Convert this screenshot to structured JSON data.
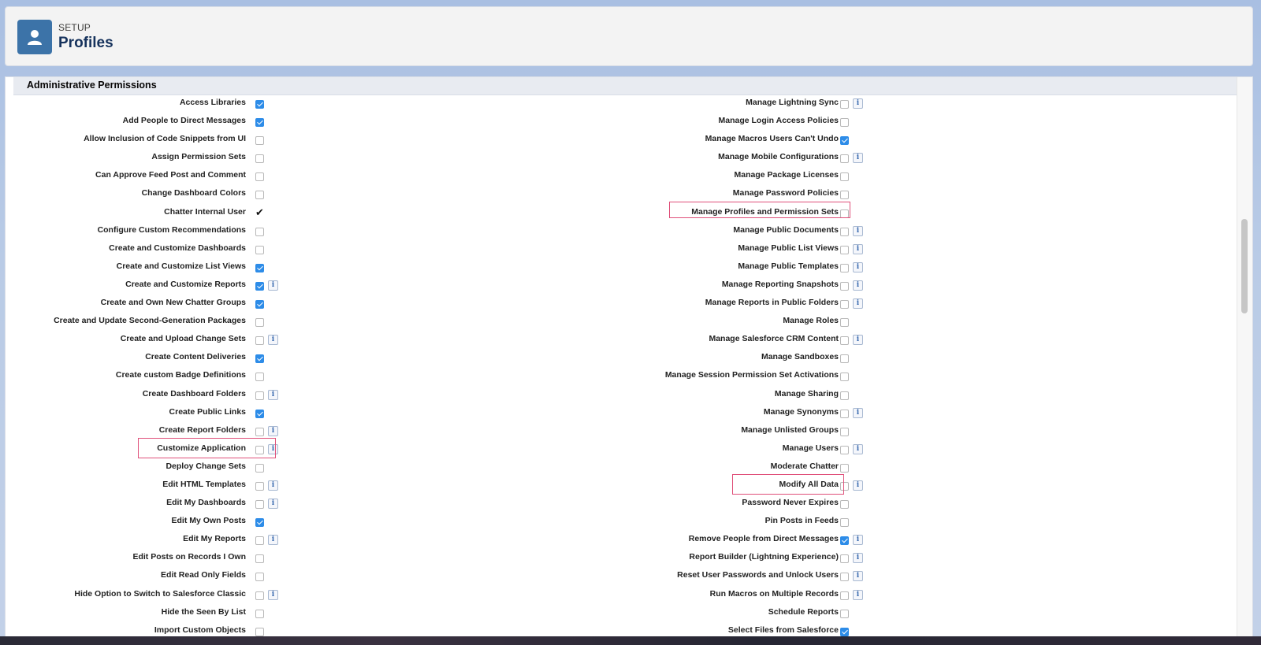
{
  "header": {
    "eyebrow": "SETUP",
    "title": "Profiles",
    "icon": "user-icon"
  },
  "section": {
    "title": "Administrative Permissions"
  },
  "left_permissions": [
    {
      "label": "Access Libraries",
      "state": "checked",
      "info": false
    },
    {
      "label": "Add People to Direct Messages",
      "state": "checked",
      "info": false
    },
    {
      "label": "Allow Inclusion of Code Snippets from UI",
      "state": "unchecked",
      "info": false
    },
    {
      "label": "Assign Permission Sets",
      "state": "unchecked",
      "info": false
    },
    {
      "label": "Can Approve Feed Post and Comment",
      "state": "unchecked",
      "info": false
    },
    {
      "label": "Change Dashboard Colors",
      "state": "unchecked",
      "info": false
    },
    {
      "label": "Chatter Internal User",
      "state": "tick",
      "info": false
    },
    {
      "label": "Configure Custom Recommendations",
      "state": "unchecked",
      "info": false
    },
    {
      "label": "Create and Customize Dashboards",
      "state": "unchecked",
      "info": false
    },
    {
      "label": "Create and Customize List Views",
      "state": "checked",
      "info": false
    },
    {
      "label": "Create and Customize Reports",
      "state": "checked",
      "info": true
    },
    {
      "label": "Create and Own New Chatter Groups",
      "state": "checked",
      "info": false
    },
    {
      "label": "Create and Update Second-Generation Packages",
      "state": "unchecked",
      "info": false
    },
    {
      "label": "Create and Upload Change Sets",
      "state": "unchecked",
      "info": true
    },
    {
      "label": "Create Content Deliveries",
      "state": "checked",
      "info": false
    },
    {
      "label": "Create custom Badge Definitions",
      "state": "unchecked",
      "info": false
    },
    {
      "label": "Create Dashboard Folders",
      "state": "unchecked",
      "info": true
    },
    {
      "label": "Create Public Links",
      "state": "checked",
      "info": false
    },
    {
      "label": "Create Report Folders",
      "state": "unchecked",
      "info": true
    },
    {
      "label": "Customize Application",
      "state": "unchecked",
      "info": true,
      "highlight": true
    },
    {
      "label": "Deploy Change Sets",
      "state": "unchecked",
      "info": false
    },
    {
      "label": "Edit HTML Templates",
      "state": "unchecked",
      "info": true
    },
    {
      "label": "Edit My Dashboards",
      "state": "unchecked",
      "info": true
    },
    {
      "label": "Edit My Own Posts",
      "state": "checked",
      "info": false
    },
    {
      "label": "Edit My Reports",
      "state": "unchecked",
      "info": true
    },
    {
      "label": "Edit Posts on Records I Own",
      "state": "unchecked",
      "info": false
    },
    {
      "label": "Edit Read Only Fields",
      "state": "unchecked",
      "info": false
    },
    {
      "label": "Hide Option to Switch to Salesforce Classic",
      "state": "unchecked",
      "info": true
    },
    {
      "label": "Hide the Seen By List",
      "state": "unchecked",
      "info": false
    },
    {
      "label": "Import Custom Objects",
      "state": "unchecked",
      "info": false
    }
  ],
  "right_permissions": [
    {
      "label": "Manage Lightning Sync",
      "state": "unchecked",
      "info": true
    },
    {
      "label": "Manage Login Access Policies",
      "state": "unchecked",
      "info": false
    },
    {
      "label": "Manage Macros Users Can't Undo",
      "state": "checked",
      "info": false
    },
    {
      "label": "Manage Mobile Configurations",
      "state": "unchecked",
      "info": true
    },
    {
      "label": "Manage Package Licenses",
      "state": "unchecked",
      "info": false
    },
    {
      "label": "Manage Password Policies",
      "state": "unchecked",
      "info": false
    },
    {
      "label": "Manage Profiles and Permission Sets",
      "state": "unchecked",
      "info": false,
      "highlight": true
    },
    {
      "label": "Manage Public Documents",
      "state": "unchecked",
      "info": true
    },
    {
      "label": "Manage Public List Views",
      "state": "unchecked",
      "info": true
    },
    {
      "label": "Manage Public Templates",
      "state": "unchecked",
      "info": true
    },
    {
      "label": "Manage Reporting Snapshots",
      "state": "unchecked",
      "info": true
    },
    {
      "label": "Manage Reports in Public Folders",
      "state": "unchecked",
      "info": true
    },
    {
      "label": "Manage Roles",
      "state": "unchecked",
      "info": false
    },
    {
      "label": "Manage Salesforce CRM Content",
      "state": "unchecked",
      "info": true
    },
    {
      "label": "Manage Sandboxes",
      "state": "unchecked",
      "info": false
    },
    {
      "label": "Manage Session Permission Set Activations",
      "state": "unchecked",
      "info": false
    },
    {
      "label": "Manage Sharing",
      "state": "unchecked",
      "info": false
    },
    {
      "label": "Manage Synonyms",
      "state": "unchecked",
      "info": true
    },
    {
      "label": "Manage Unlisted Groups",
      "state": "unchecked",
      "info": false
    },
    {
      "label": "Manage Users",
      "state": "unchecked",
      "info": true
    },
    {
      "label": "Moderate Chatter",
      "state": "unchecked",
      "info": false
    },
    {
      "label": "Modify All Data",
      "state": "unchecked",
      "info": true,
      "highlight": true
    },
    {
      "label": "Password Never Expires",
      "state": "unchecked",
      "info": false
    },
    {
      "label": "Pin Posts in Feeds",
      "state": "unchecked",
      "info": false
    },
    {
      "label": "Remove People from Direct Messages",
      "state": "checked",
      "info": true
    },
    {
      "label": "Report Builder (Lightning Experience)",
      "state": "unchecked",
      "info": true
    },
    {
      "label": "Reset User Passwords and Unlock Users",
      "state": "unchecked",
      "info": true
    },
    {
      "label": "Run Macros on Multiple Records",
      "state": "unchecked",
      "info": true
    },
    {
      "label": "Schedule Reports",
      "state": "unchecked",
      "info": false
    },
    {
      "label": "Select Files from Salesforce",
      "state": "checked",
      "info": false
    }
  ],
  "info_glyph": "i",
  "colors": {
    "accent": "#2d8ce8",
    "icon_bg": "#3c73a8",
    "highlight": "#e0507a"
  }
}
